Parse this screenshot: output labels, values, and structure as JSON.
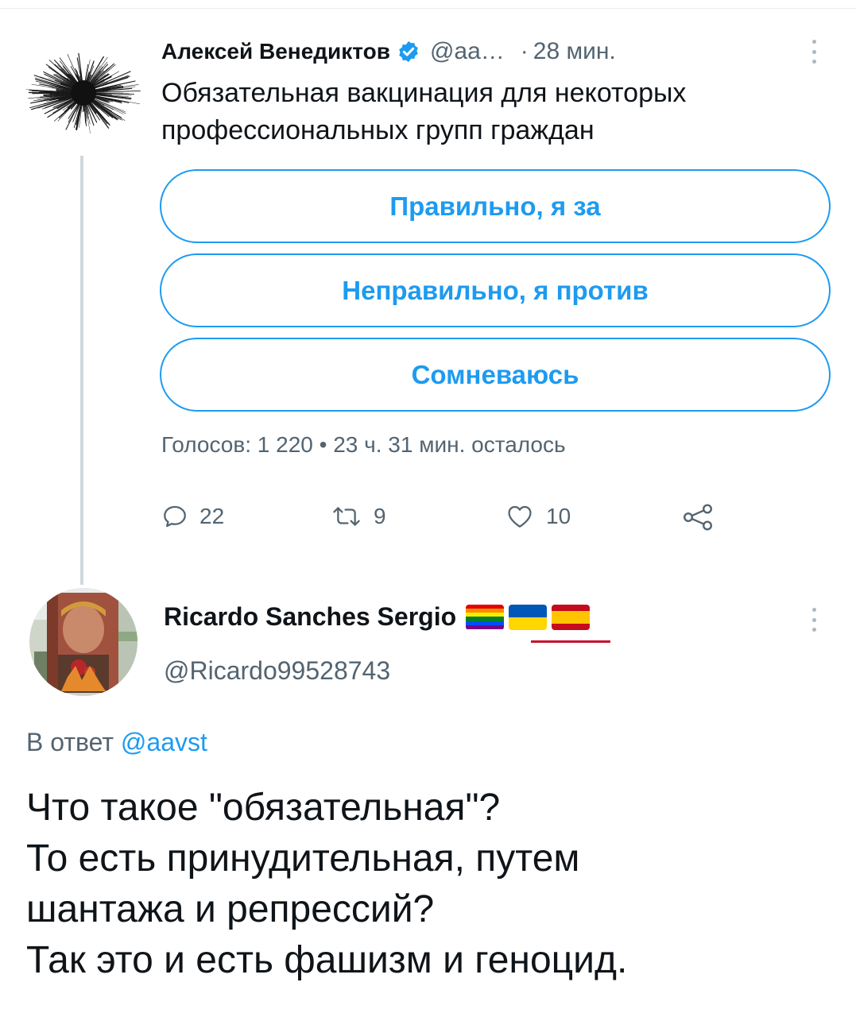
{
  "tweet": {
    "author_name": "Алексей Венедиктов",
    "author_handle": "@аа…",
    "separator": "·",
    "time": "28 мин.",
    "text": "Обязательная вакцинация для некоторых профессиональных групп граждан",
    "poll": {
      "options": [
        "Правильно, я за",
        "Неправильно, я против",
        "Сомневаюсь"
      ],
      "info": "Голосов: 1 220 • 23 ч. 31 мин. осталось"
    },
    "actions": {
      "replies": "22",
      "retweets": "9",
      "likes": "10"
    }
  },
  "reply": {
    "author_name": "Ricardo Sanches Sergio",
    "author_handle": "@Ricardo99528743",
    "reply_prefix": "В ответ",
    "reply_mention": "@aavst",
    "text_lines": [
      "Что такое \"обязательная\"?",
      "То есть принудительная, путем",
      "шантажа и репрессий?",
      "Так это и есть фашизм и геноцид."
    ]
  },
  "icons": {
    "verified": "verified-badge-icon",
    "more": "more-vertical-icon",
    "reply": "reply-icon",
    "retweet": "retweet-icon",
    "like": "heart-icon",
    "share": "share-icon"
  },
  "colors": {
    "accent": "#1d9bf0",
    "secondary_text": "#536471",
    "primary_text": "#0f1419"
  }
}
